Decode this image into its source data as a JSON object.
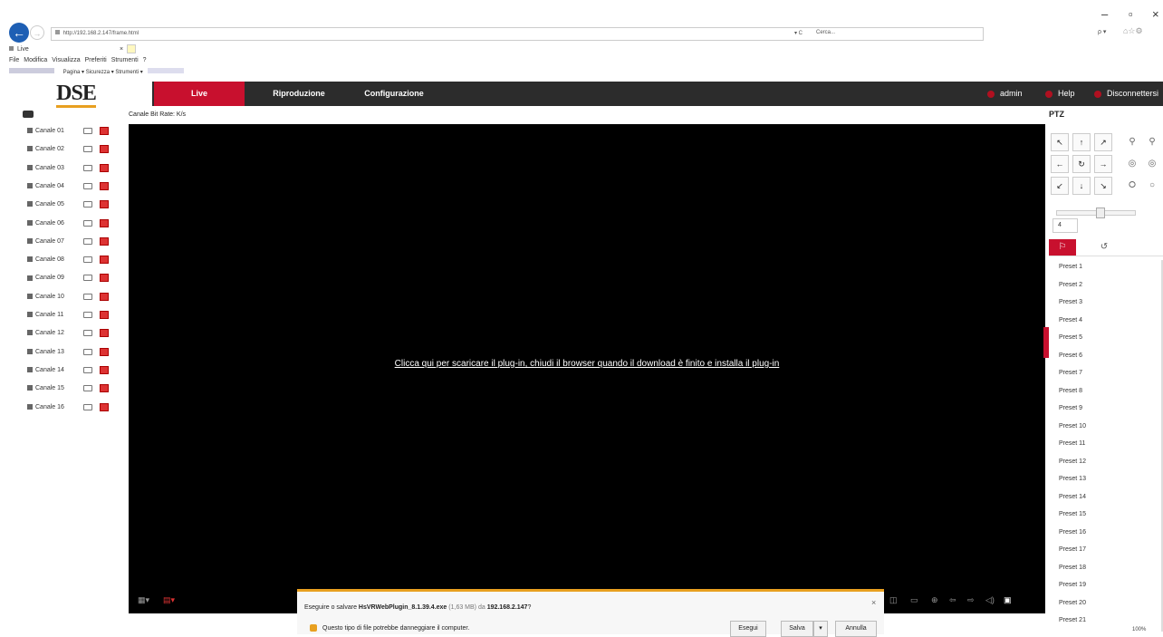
{
  "window": {
    "minimize": "–",
    "restore": "▫",
    "close": "×"
  },
  "browser": {
    "url": "http://192.168.2.147/frame.html",
    "refresh": "▾ C",
    "search_placeholder": "Cerca...",
    "search_right": "ρ ▾",
    "toolbar_right": "⌂☆⚙",
    "tab_label": "Live",
    "tab_close": "×",
    "menu": [
      "File",
      "Modifica",
      "Visualizza",
      "Preferiti",
      "Strumenti",
      "?"
    ],
    "command_bar": "Pagina ▾  Sicurezza ▾  Strumenti ▾"
  },
  "app": {
    "logo": "DSE",
    "nav": [
      {
        "label": "Live"
      },
      {
        "label": "Riproduzione"
      },
      {
        "label": "Configurazione"
      }
    ],
    "user": "admin",
    "help": "Help",
    "logout": "Disconnettersi"
  },
  "info_bar": {
    "label": "Canale   Bit Rate: K/s"
  },
  "channels": [
    "Canale 01",
    "Canale 02",
    "Canale 03",
    "Canale 04",
    "Canale 05",
    "Canale 06",
    "Canale 07",
    "Canale 08",
    "Canale 09",
    "Canale 10",
    "Canale 11",
    "Canale 12",
    "Canale 13",
    "Canale 14",
    "Canale 15",
    "Canale 16"
  ],
  "video": {
    "plugin_link": "Clicca qui per scaricare il plug-in, chiudi il browser quando il download è finito e installa il plug-in"
  },
  "download_bar": {
    "prefix": "Eseguire o salvare ",
    "file": "HsVRWebPlugin_8.1.39.4.exe",
    "size": " (1,63 MB) da ",
    "host": "192.168.2.147",
    "suffix": "?",
    "warning": "Questo tipo di file potrebbe danneggiare il computer.",
    "run": "Esegui",
    "save": "Salva",
    "save_arrow": "▾",
    "cancel": "Annulla",
    "close": "×"
  },
  "ptz": {
    "title": "PTZ",
    "speed": "4",
    "presets": [
      "Preset 1",
      "Preset 2",
      "Preset 3",
      "Preset 4",
      "Preset 5",
      "Preset 6",
      "Preset 7",
      "Preset 8",
      "Preset 9",
      "Preset 10",
      "Preset 11",
      "Preset 12",
      "Preset 13",
      "Preset 14",
      "Preset 15",
      "Preset 16",
      "Preset 17",
      "Preset 18",
      "Preset 19",
      "Preset 20",
      "Preset 21"
    ]
  },
  "zoom": "100%",
  "colors": {
    "accent": "#c8102e",
    "appbar": "#2c2c2c",
    "download_accent": "#e8a020"
  }
}
